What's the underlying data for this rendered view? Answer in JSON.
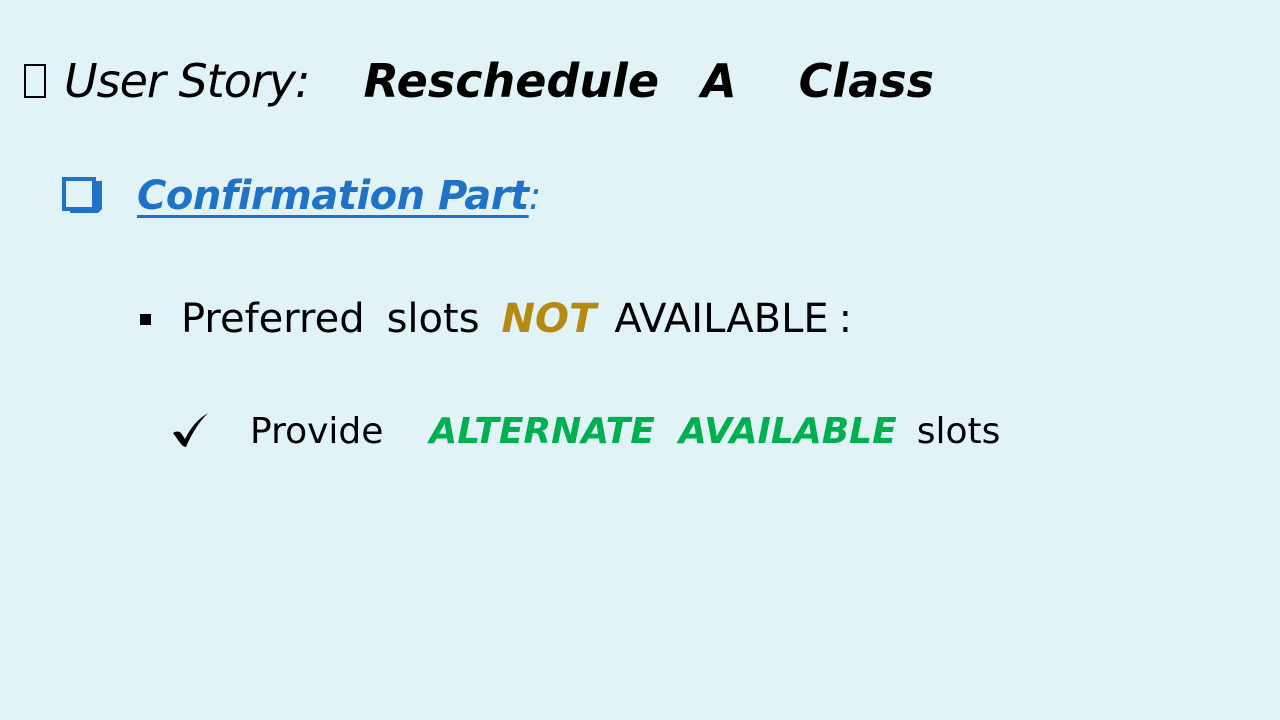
{
  "title": {
    "prefix": "User Story:",
    "word1": "Reschedule",
    "word2": "A",
    "word3": "Class"
  },
  "section": {
    "title": "Confirmation Part",
    "colon": ":"
  },
  "bullet": {
    "word1": "Preferred",
    "word2": "slots",
    "emphasis": "NOT",
    "word3": "AVAILABLE",
    "colon": ":"
  },
  "sub_bullet": {
    "word1": "Provide",
    "emphasis1": "ALTERNATE",
    "emphasis2": "AVAILABLE",
    "word2": "slots"
  },
  "colors": {
    "background": "#e2f3f8",
    "section_blue": "#1f72c4",
    "not_gold": "#b58a12",
    "alternate_green": "#00b050"
  },
  "icons": {
    "title_glyph": "missing-glyph-icon",
    "section_bullet": "checkbox-icon",
    "bullet": "square-bullet-icon",
    "sub_bullet": "checkmark-icon"
  }
}
